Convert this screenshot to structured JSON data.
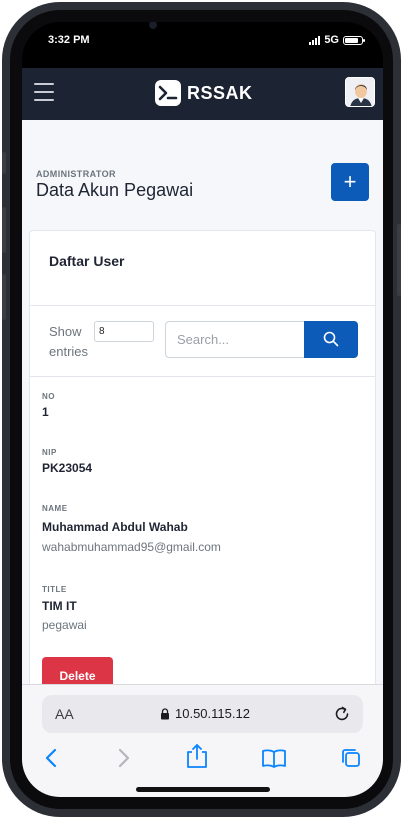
{
  "status": {
    "time": "3:32 PM",
    "network": "5G"
  },
  "navbar": {
    "brand": "RSSAK",
    "menu_icon": "hamburger-menu-icon",
    "brand_icon": "terminal-prompt-icon",
    "avatar_icon": "user-avatar"
  },
  "header": {
    "eyebrow": "ADMINISTRATOR",
    "title": "Data Akun Pegawai",
    "add_label": "+"
  },
  "card": {
    "title": "Daftar User",
    "show_label": "Show entries",
    "entries_value": "8",
    "search_placeholder": "Search...",
    "search_icon": "search-icon"
  },
  "record": {
    "no_label": "NO",
    "no_value": "1",
    "nip_label": "NIP",
    "nip_value": "PK23054",
    "name_label": "NAME",
    "name_value": "Muhammad Abdul Wahab",
    "email": "wahabmuhammad95@gmail.com",
    "title_label": "TITLE",
    "title_value": "TIM IT",
    "role": "pegawai",
    "delete_label": "Delete"
  },
  "safari": {
    "aa_label": "AA",
    "url": "10.50.115.12"
  },
  "colors": {
    "navbar": "#1c2433",
    "primary": "#0d5bb8",
    "danger": "#dc3545"
  }
}
